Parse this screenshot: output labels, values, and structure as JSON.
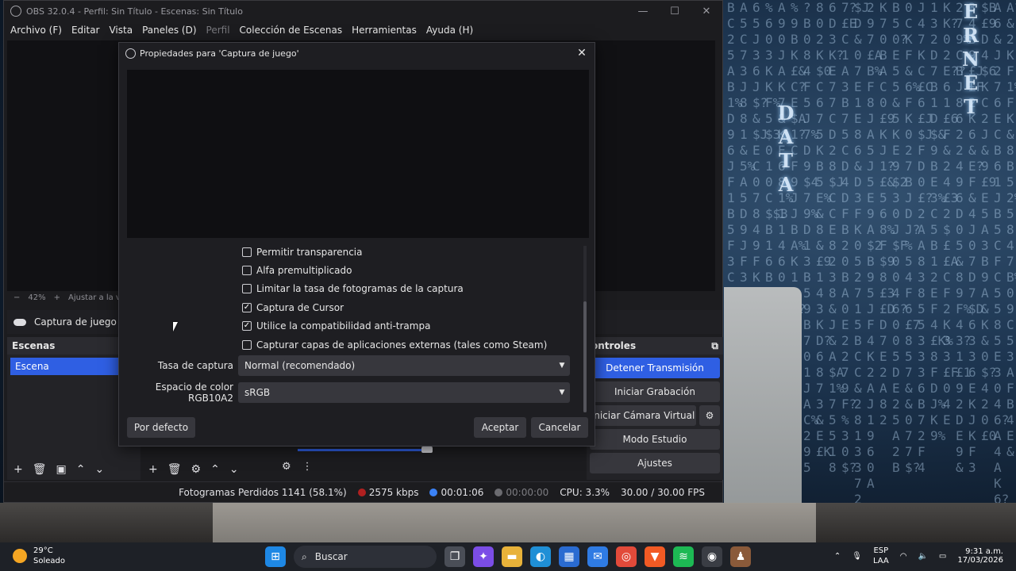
{
  "window": {
    "title": "OBS 32.0.4 - Perfil: Sin Título - Escenas: Sin Título",
    "controls": [
      "—",
      "☐",
      "✕"
    ]
  },
  "menu": [
    {
      "label": "Archivo (F)",
      "enabled": true
    },
    {
      "label": "Editar",
      "enabled": true
    },
    {
      "label": "Vista",
      "enabled": true
    },
    {
      "label": "Paneles (D)",
      "enabled": true
    },
    {
      "label": "Perfil",
      "enabled": false
    },
    {
      "label": "Colección de Escenas",
      "enabled": true
    },
    {
      "label": "Herramientas",
      "enabled": true
    },
    {
      "label": "Ayuda (H)",
      "enabled": true
    }
  ],
  "zoom": {
    "minus": "−",
    "value": "42%",
    "plus": "+",
    "fit_label": "Ajustar a la ve"
  },
  "source_bar": {
    "name": "Captura de juego",
    "icon": "gamepad-icon"
  },
  "scenes": {
    "title": "Escenas",
    "items": [
      "Escena"
    ]
  },
  "controls": {
    "title": "ontroles",
    "buttons": {
      "stop_stream": "Detener Transmisión",
      "start_record": "Iniciar Grabación",
      "virtual_cam": "Iniciar Cámara Virtual",
      "studio_mode": "Modo Estudio",
      "settings": "Ajustes"
    }
  },
  "status": {
    "dropped": "Fotogramas Perdidos 1141 (58.1%)",
    "bitrate": "2575 kbps",
    "stream_time": "00:01:06",
    "record_time": "00:00:00",
    "cpu": "CPU: 3.3%",
    "fps": "30.00 / 30.00 FPS",
    "colors": {
      "bitrate_dot": "#b02020",
      "stream_dot": "#3b82f6",
      "record_dot": "#6b6b70"
    }
  },
  "dialog": {
    "title": "Propiedades para 'Captura de juego'",
    "options": [
      {
        "label": "Permitir transparencia",
        "checked": false
      },
      {
        "label": "Alfa premultiplicado",
        "checked": false
      },
      {
        "label": "Limitar la tasa de fotogramas de la captura",
        "checked": false
      },
      {
        "label": "Captura de Cursor",
        "checked": true
      },
      {
        "label": "Utilice la compatibilidad anti-trampa",
        "checked": true
      },
      {
        "label": "Capturar capas de aplicaciones externas (tales como Steam)",
        "checked": false
      }
    ],
    "capture_rate": {
      "label": "Tasa de captura",
      "value": "Normal (recomendado)"
    },
    "color_space": {
      "label": "Espacio de color RGB10A2",
      "value": "sRGB"
    },
    "buttons": {
      "defaults": "Por defecto",
      "ok": "Aceptar",
      "cancel": "Cancelar"
    }
  },
  "taskbar": {
    "weather": {
      "temp": "29°C",
      "condition": "Soleado"
    },
    "search": "Buscar",
    "lang": {
      "top": "ESP",
      "bottom": "LAA"
    },
    "time": "9:31 a.m.",
    "date": "17/03/2026"
  },
  "colors": {
    "accent": "#2f5fe3",
    "dialog_bg": "#1e1e22",
    "button": "#37373d"
  }
}
